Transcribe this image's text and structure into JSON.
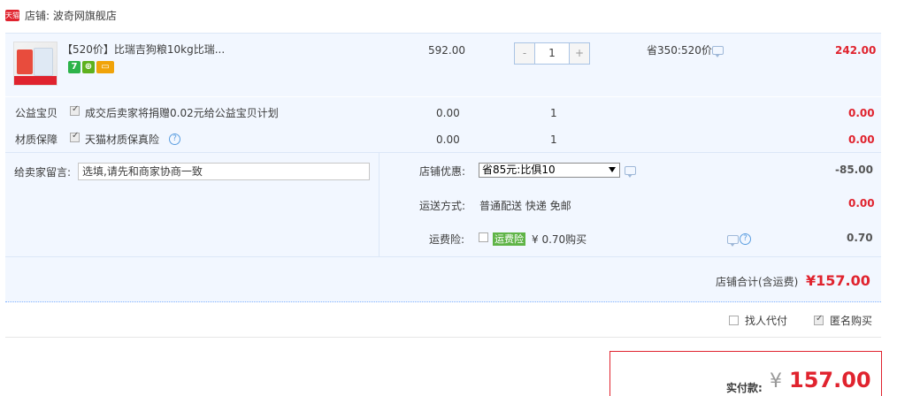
{
  "shop": {
    "badge": "天猫",
    "label": "店铺: 波奇网旗舰店"
  },
  "item": {
    "title": "【520价】比瑞吉狗粮10kg比瑞...",
    "tags": [
      "7",
      "",
      ""
    ],
    "price": "592.00",
    "quantity": "1",
    "qty_minus": "-",
    "qty_plus": "+",
    "promo": "省350:520价",
    "subtotal": "242.00"
  },
  "services": [
    {
      "name": "公益宝贝",
      "desc": "成交后卖家将捐赠0.02元给公益宝贝计划",
      "price": "0.00",
      "qty": "1",
      "total": "0.00",
      "checked": true
    },
    {
      "name": "材质保障",
      "desc": "天猫材质保真险",
      "price": "0.00",
      "qty": "1",
      "total": "0.00",
      "checked": true
    }
  ],
  "message": {
    "label": "给卖家留言:",
    "value": "选填,请先和商家协商一致"
  },
  "shop_discount": {
    "label": "店铺优惠:",
    "selected": "省85元:比俱10",
    "amount": "-85.00"
  },
  "shipping": {
    "label": "运送方式:",
    "value": "普通配送 快递 免邮",
    "amount": "0.00"
  },
  "freight_insurance": {
    "label": "运费险:",
    "tag": "运费险",
    "desc": "¥ 0.70购买",
    "amount": "0.70"
  },
  "shop_total": {
    "label": "店铺合计(含运费)",
    "value": "¥157.00"
  },
  "options": {
    "proxy_pay": "找人代付",
    "anonymous": "匿名购买"
  },
  "payment": {
    "label": "实付款:",
    "currency": "¥",
    "amount": "157.00"
  }
}
